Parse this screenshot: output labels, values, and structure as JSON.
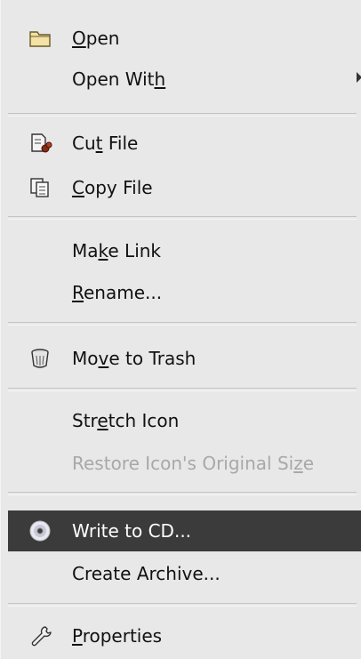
{
  "menu": {
    "items": [
      {
        "pre": "",
        "accel": "O",
        "post": "pen",
        "icon": "folder-icon"
      },
      {
        "pre": "Open Wit",
        "accel": "h",
        "post": "",
        "submenu": true
      },
      {
        "pre": "Cu",
        "accel": "t",
        "post": " File",
        "icon": "cut-file-icon"
      },
      {
        "pre": "",
        "accel": "C",
        "post": "opy File",
        "icon": "copy-file-icon"
      },
      {
        "pre": "Ma",
        "accel": "k",
        "post": "e Link"
      },
      {
        "pre": "",
        "accel": "R",
        "post": "ename..."
      },
      {
        "pre": "Mo",
        "accel": "v",
        "post": "e to Trash",
        "icon": "trash-icon"
      },
      {
        "pre": "Str",
        "accel": "e",
        "post": "tch Icon"
      },
      {
        "pre": "Restore Icon's Original Si",
        "accel": "z",
        "post": "e",
        "disabled": true
      },
      {
        "pre": "Write to CD...",
        "accel": "",
        "post": "",
        "icon": "cd-icon",
        "highlighted": true
      },
      {
        "pre": "Create Archive...",
        "accel": "",
        "post": ""
      },
      {
        "pre": "",
        "accel": "P",
        "post": "roperties",
        "icon": "wrench-icon"
      }
    ]
  },
  "colors": {
    "background": "#e8e8e8",
    "highlight": "#3b3b3b",
    "disabled_text": "#a8a8a8"
  }
}
